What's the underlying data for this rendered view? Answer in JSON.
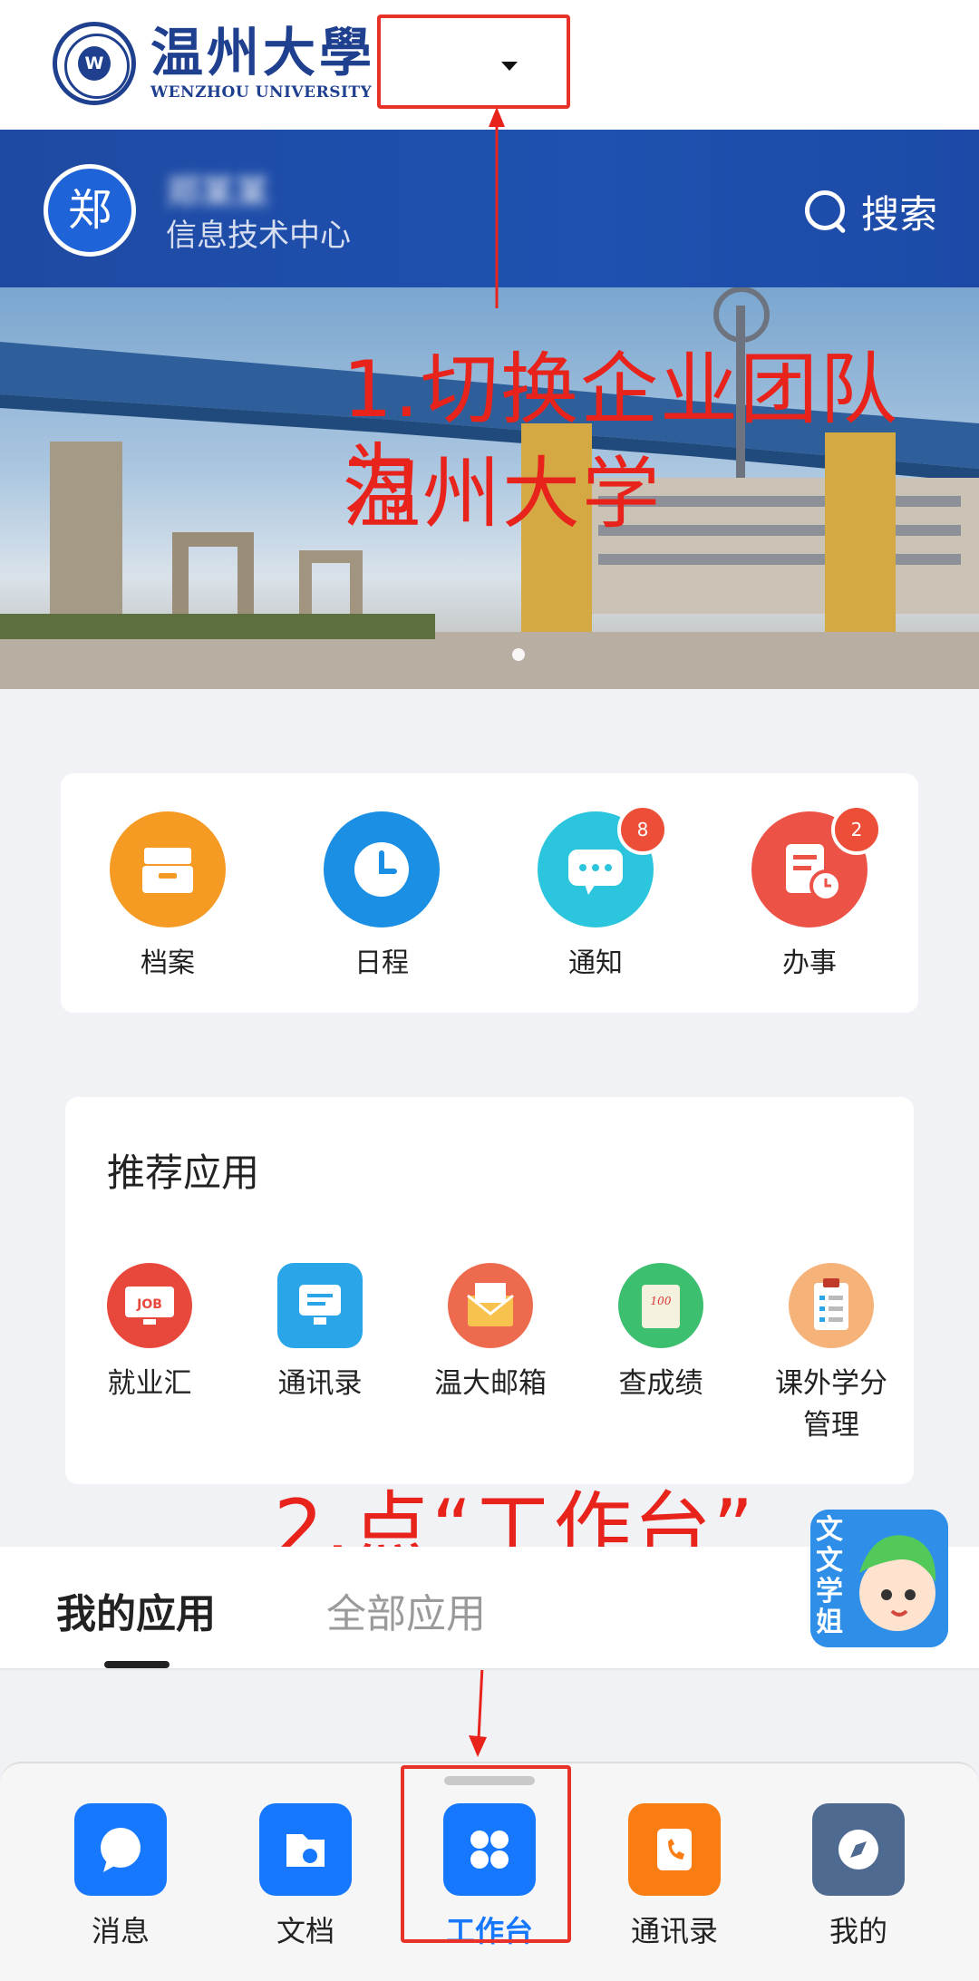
{
  "header": {
    "logo": {
      "cn": "温州大學",
      "en": "WENZHOU UNIVERSITY",
      "seal_mark": "W"
    },
    "team_selector": {
      "value": "",
      "icon": "caret-down-icon"
    }
  },
  "profile": {
    "avatar_text": "郑",
    "name": "郑某某",
    "department": "信息技术中心",
    "search_label": "搜索"
  },
  "annotations": {
    "step1_line1": "1.切换企业团队为",
    "step1_line2": "温州大学",
    "step2": "2.点“工作台”",
    "color": "#e8231c"
  },
  "quick_actions": [
    {
      "label": "档案",
      "icon": "archive-box-icon",
      "color": "#f59a23"
    },
    {
      "label": "日程",
      "icon": "clock-icon",
      "color": "#1a8fe3"
    },
    {
      "label": "通知",
      "icon": "chat-bubble-icon",
      "color": "#2bc6dd",
      "badge": "8"
    },
    {
      "label": "办事",
      "icon": "document-clock-icon",
      "color": "#ec5246",
      "badge": "2"
    }
  ],
  "recommended": {
    "title": "推荐应用",
    "items": [
      {
        "label": "就业汇",
        "icon": "job-monitor-icon",
        "color": "#e8483c",
        "mark": "JOB"
      },
      {
        "label": "通讯录",
        "icon": "monitor-contacts-icon",
        "color": "#2aa6e8"
      },
      {
        "label": "温大邮箱",
        "icon": "envelope-icon",
        "color": "#ee6a4e"
      },
      {
        "label": "查成绩",
        "icon": "score-scroll-icon",
        "color": "#3cbf6f",
        "mark": "100"
      },
      {
        "label": "课外学分",
        "label2": "管理",
        "icon": "clipboard-icon",
        "color": "#f5b37a"
      }
    ]
  },
  "app_tabs": {
    "mine": "我的应用",
    "all": "全部应用"
  },
  "mascot": {
    "text": "文文学姐"
  },
  "tabbar": [
    {
      "label": "消息",
      "icon": "message-bubble-icon",
      "color": "#1677ff"
    },
    {
      "label": "文档",
      "icon": "folder-icon",
      "color": "#1677ff"
    },
    {
      "label": "工作台",
      "icon": "grid-four-icon",
      "color": "#1677ff",
      "active": true
    },
    {
      "label": "通讯录",
      "icon": "phone-book-icon",
      "color": "#fa7d14"
    },
    {
      "label": "我的",
      "icon": "compass-icon",
      "color": "#4f6a91"
    }
  ]
}
